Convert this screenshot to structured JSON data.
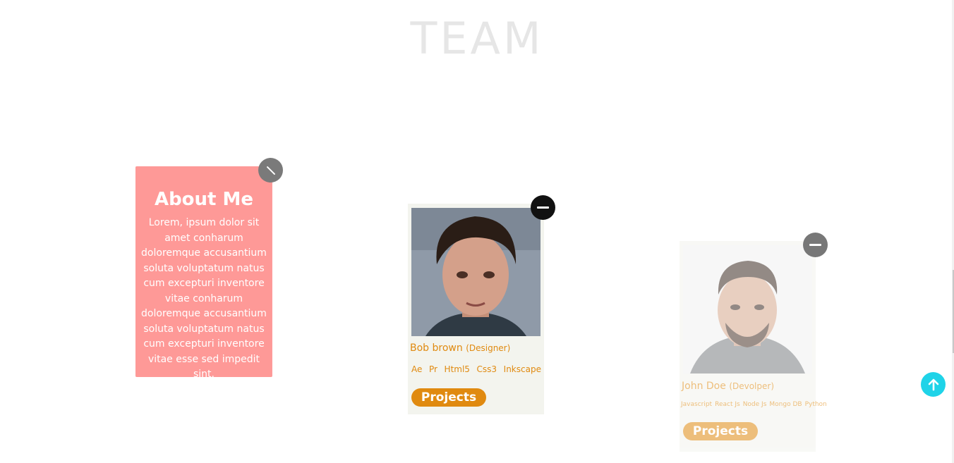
{
  "page": {
    "title": "TEAM"
  },
  "cards": [
    {
      "about_title": "About Me",
      "about_text": "Lorem, ipsum dolor sit amet conharum doloremque accusantium soluta voluptatum natus cum excepturi inventore vitae conharum doloremque accusantium soluta voluptatum natus cum excepturi inventore vitae esse sed impedit sint."
    },
    {
      "name": "Bob brown",
      "role": "(Designer)",
      "skills": [
        "Ae",
        "Pr",
        "Html5",
        "Css3",
        "Inkscape"
      ],
      "button": "Projects"
    },
    {
      "name": "John Doe",
      "role": "(Devolper)",
      "skills": [
        "Javascript",
        "React Js",
        "Node Js",
        "Mongo DB",
        "Python"
      ],
      "button": "Projects"
    }
  ],
  "colors": {
    "accent": "#e08a10",
    "scroll_top": "#1fd3e8",
    "about_overlay": "#ff7878"
  },
  "icons": {
    "toggle_open": "minus-icon",
    "toggle_close": "close-icon",
    "scroll_top": "arrow-up-icon"
  }
}
